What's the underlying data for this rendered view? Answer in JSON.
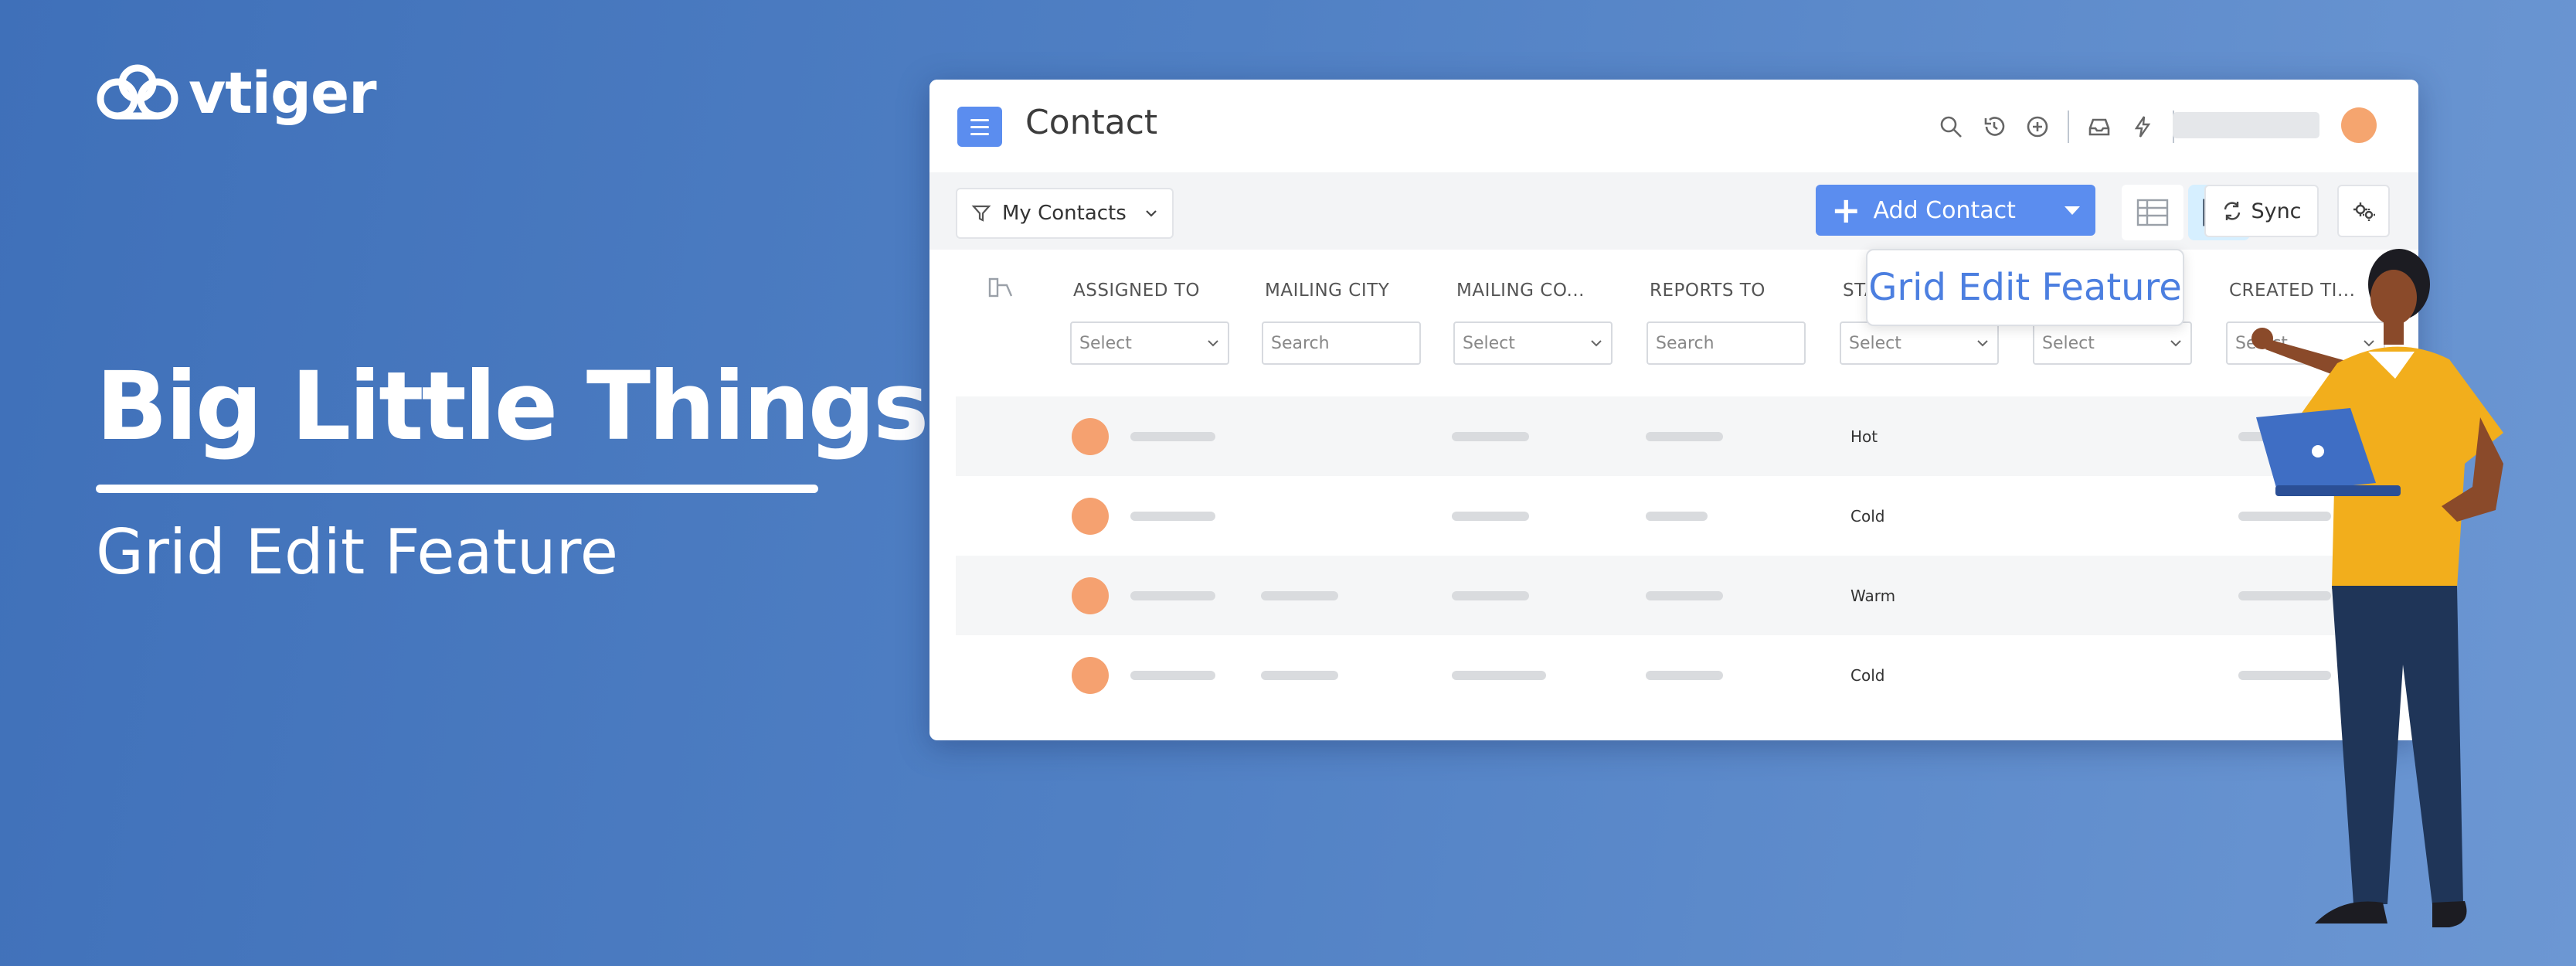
{
  "brand": {
    "name": "vtiger"
  },
  "hero": {
    "headline": "Big Little Things",
    "subline": "Grid Edit Feature"
  },
  "app": {
    "title": "Contact",
    "filter_label": "My Contacts",
    "add_button_label": "Add Contact",
    "sync_label": "Sync",
    "tooltip": "Grid Edit Feature",
    "columns": [
      {
        "label": "ASSIGNED TO",
        "input_type": "select",
        "placeholder": "Select"
      },
      {
        "label": "MAILING CITY",
        "input_type": "search",
        "placeholder": "Search"
      },
      {
        "label": "MAILING CO...",
        "input_type": "select",
        "placeholder": "Select"
      },
      {
        "label": "REPORTS TO",
        "input_type": "search",
        "placeholder": "Search"
      },
      {
        "label": "STA",
        "input_type": "select",
        "placeholder": "Select"
      },
      {
        "label": "",
        "input_type": "select",
        "placeholder": "Select"
      },
      {
        "label": "CREATED TI...",
        "input_type": "select",
        "placeholder": "Select"
      }
    ],
    "rows": [
      {
        "status": "Hot"
      },
      {
        "status": "Cold"
      },
      {
        "status": "Warm"
      },
      {
        "status": "Cold"
      }
    ]
  },
  "colors": {
    "accent": "#5b8def",
    "avatar": "#f5a170",
    "tooltip_text": "#4c7fe0",
    "shirt": "#f2ae1c",
    "pants": "#1f3558",
    "laptop": "#3f6ec4"
  }
}
